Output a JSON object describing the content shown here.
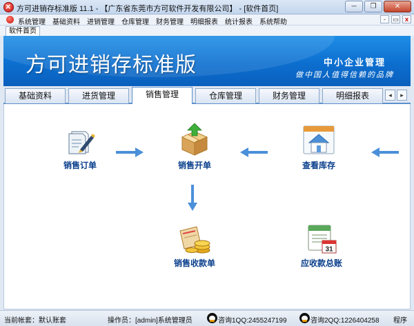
{
  "window": {
    "title": "方可进销存标准版 11.1 - 【广东省东莞市方可软件开发有限公司】 - [软件首页]",
    "minimize_glyph": "─",
    "restore_glyph": "❐",
    "close_glyph": "✕"
  },
  "menubar": {
    "items": [
      "系统管理",
      "基础资料",
      "进销管理",
      "仓库管理",
      "财务管理",
      "明细报表",
      "统计报表",
      "系统帮助"
    ],
    "mdi_min": "-",
    "mdi_restore": "▭",
    "mdi_close": "x"
  },
  "doc_tab": {
    "label": "软件首页"
  },
  "banner": {
    "title": "方可进销存标准版",
    "slogan": "中小企业管理",
    "subtitle": "做中国人值得信赖的品牌"
  },
  "module_tabs": {
    "items": [
      "基础资料",
      "进货管理",
      "销售管理",
      "仓库管理",
      "财务管理",
      "明细报表"
    ],
    "active": "销售管理",
    "prev_glyph": "◂",
    "next_glyph": "▸"
  },
  "flow": {
    "sales_order": {
      "label": "销售订单",
      "icon": "order-document-pen-icon"
    },
    "sales_invoice": {
      "label": "销售开单",
      "icon": "box-upload-icon"
    },
    "view_stock": {
      "label": "查看库存",
      "icon": "warehouse-house-icon"
    },
    "sales_receipt": {
      "label": "销售收款单",
      "icon": "coins-receipt-icon"
    },
    "receivable_ledger": {
      "label": "应收款总账",
      "icon": "calendar-ledger-icon"
    },
    "calendar_day": "31"
  },
  "statusbar": {
    "account": "当前帐套：默认账套",
    "operator": "操作员：[admin]系统管理员",
    "qq1": "咨询1QQ:2455247199",
    "qq2": "咨询2QQ:1226404258",
    "trail": "程序"
  },
  "colors": {
    "banner_blue": "#0c6fd0",
    "label_blue": "#0a3f8c",
    "arrow_blue": "#4a8fd9"
  }
}
